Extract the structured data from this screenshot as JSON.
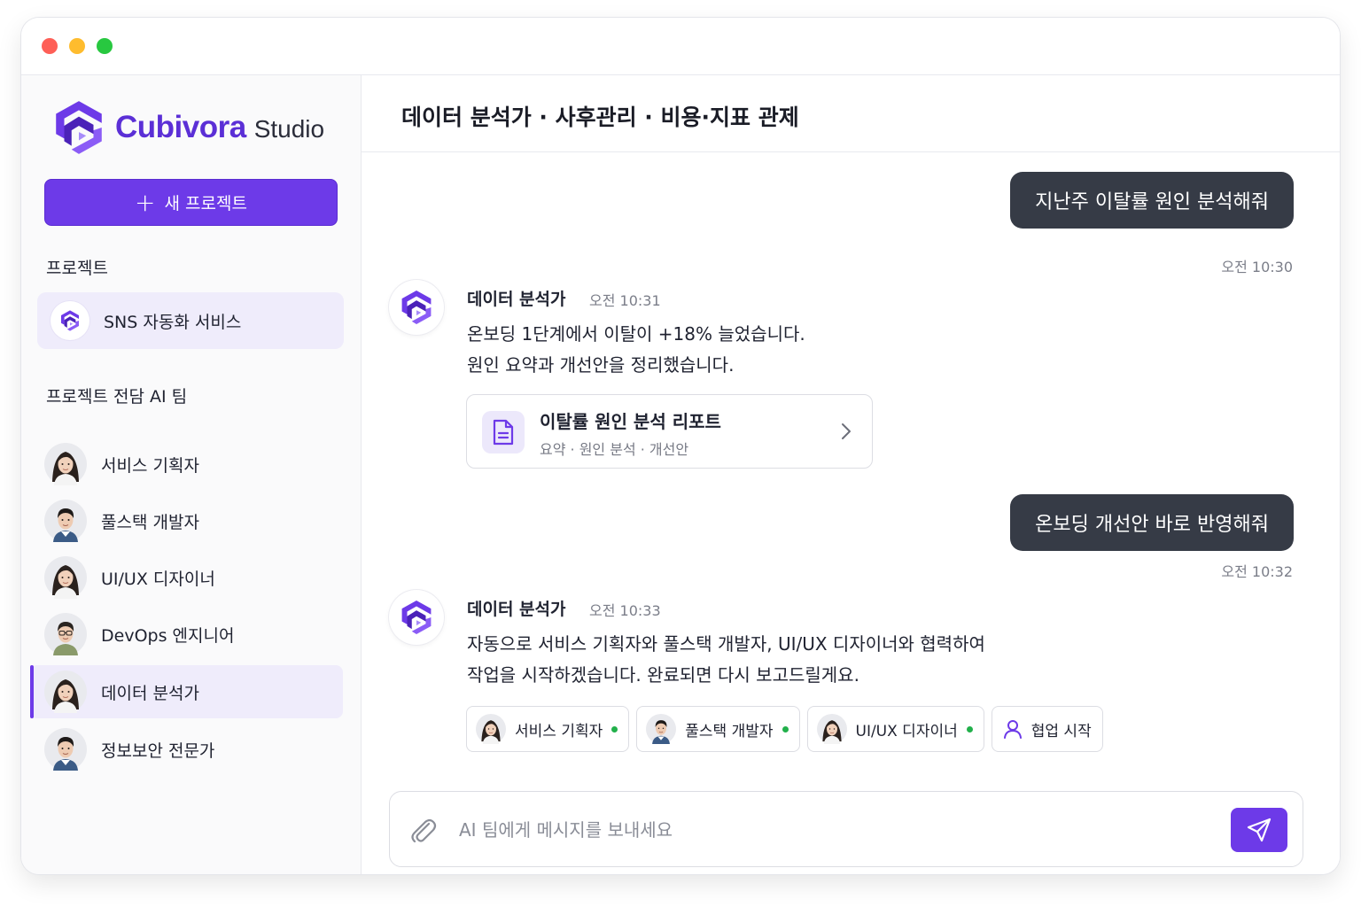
{
  "app": {
    "brand_name": "Cubivora",
    "brand_suffix": "Studio",
    "accent_color": "#6d3ae8"
  },
  "window_controls": [
    "close",
    "minimize",
    "maximize"
  ],
  "sidebar": {
    "new_project_label": "새 프로젝트",
    "projects_heading": "프로젝트",
    "projects": [
      {
        "label": "SNS 자동화 서비스",
        "icon": "cube-logo-icon",
        "selected": true
      }
    ],
    "team_heading": "프로젝트 전담 AI 팀",
    "team": [
      {
        "label": "서비스 기획자",
        "avatar": "avatar-woman",
        "active": false
      },
      {
        "label": "풀스택 개발자",
        "avatar": "avatar-man",
        "active": false
      },
      {
        "label": "UI/UX 디자이너",
        "avatar": "avatar-woman",
        "active": false
      },
      {
        "label": "DevOps 엔지니어",
        "avatar": "avatar-man-glasses",
        "active": false
      },
      {
        "label": "데이터 분석가",
        "avatar": "avatar-woman",
        "active": true
      },
      {
        "label": "정보보안 전문가",
        "avatar": "avatar-man",
        "active": false
      }
    ]
  },
  "header": {
    "title": "데이터 분석가 · 사후관리 · 비용·지표 관제"
  },
  "chat": {
    "messages": [
      {
        "role": "user",
        "text": "지난주 이탈률 원인 분석해줘",
        "time": "오전 10:30"
      },
      {
        "role": "bot",
        "sender": "데이터 분석가",
        "time": "오전 10:31",
        "lines": [
          "온보딩 1단계에서 이탈이 +18% 늘었습니다.",
          "원인 요약과 개선안을 정리했습니다."
        ],
        "attachment": {
          "title": "이탈률 원인 분석 리포트",
          "subtitle": "요약 · 원인 분석 · 개선안",
          "icon": "document-icon"
        }
      },
      {
        "role": "user",
        "text": "온보딩 개선안 바로 반영해줘",
        "time": "오전 10:32"
      },
      {
        "role": "bot",
        "sender": "데이터 분석가",
        "time": "오전 10:33",
        "lines": [
          "자동으로 서비스 기획자와 풀스택 개발자, UI/UX 디자이너와 협력하여",
          "작업을 시작하겠습니다. 완료되면 다시 보고드릴게요."
        ],
        "chips": [
          {
            "label": "서비스 기획자",
            "online": true
          },
          {
            "label": "풀스택 개발자",
            "online": true
          },
          {
            "label": "UI/UX 디자이너",
            "online": true
          },
          {
            "label": "협업 시작",
            "icon": "user-icon"
          }
        ]
      }
    ]
  },
  "composer": {
    "placeholder": "AI 팀에게 메시지를 보내세요",
    "value": ""
  }
}
